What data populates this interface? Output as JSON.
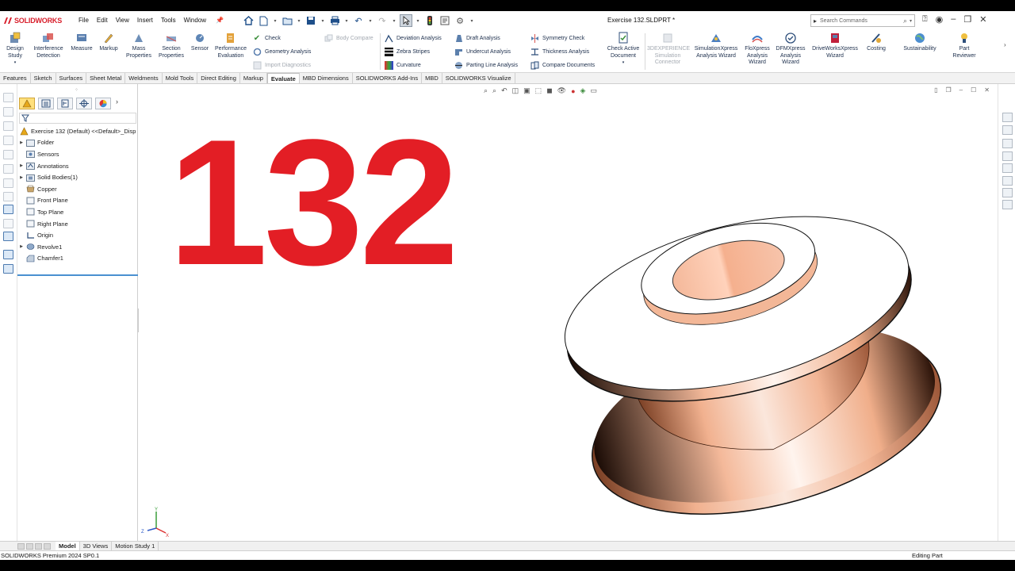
{
  "app": {
    "brand": "SOLIDWORKS",
    "document_title": "Exercise 132.SLDPRT *"
  },
  "menu": [
    "File",
    "Edit",
    "View",
    "Insert",
    "Tools",
    "Window"
  ],
  "search": {
    "placeholder": "Search Commands"
  },
  "ribbon": {
    "design_study": "Design Study",
    "interference_detection": "Interference Detection",
    "measure": "Measure",
    "markup": "Markup",
    "mass_properties": "Mass Properties",
    "section_properties": "Section Properties",
    "sensor": "Sensor",
    "performance_evaluation": "Performance Evaluation",
    "check": "Check",
    "geometry_analysis": "Geometry Analysis",
    "import_diagnostics": "Import Diagnostics",
    "body_compare": "Body Compare",
    "deviation_analysis": "Deviation Analysis",
    "zebra_stripes": "Zebra Stripes",
    "curvature": "Curvature",
    "draft_analysis": "Draft Analysis",
    "undercut_analysis": "Undercut Analysis",
    "parting_line_analysis": "Parting Line Analysis",
    "symmetry_check": "Symmetry Check",
    "thickness_analysis": "Thickness Analysis",
    "compare_documents": "Compare Documents",
    "check_active_document": "Check Active Document",
    "simulation_connector": "3DEXPERIENCE Simulation Connector",
    "simulationxpress": "SimulationXpress Analysis Wizard",
    "floxpress": "FloXpress Analysis Wizard",
    "dfmxpress": "DFMXpress Analysis Wizard",
    "driveworksxpress": "DriveWorksXpress Wizard",
    "costing": "Costing",
    "sustainability": "Sustainability",
    "part_reviewer": "Part Reviewer"
  },
  "tabs": [
    "Features",
    "Sketch",
    "Surfaces",
    "Sheet Metal",
    "Weldments",
    "Mold Tools",
    "Direct Editing",
    "Markup",
    "Evaluate",
    "MBD Dimensions",
    "SOLIDWORKS Add-Ins",
    "MBD",
    "SOLIDWORKS Visualize"
  ],
  "active_tab": "Evaluate",
  "tree": {
    "root": "Exercise 132 (Default) <<Default>_Disp",
    "items": [
      "Folder",
      "Sensors",
      "Annotations",
      "Solid Bodies(1)",
      "Copper",
      "Front Plane",
      "Top Plane",
      "Right Plane",
      "Origin",
      "Revolve1",
      "Chamfer1"
    ]
  },
  "viewport": {
    "overlay_number": "132",
    "material": "Copper",
    "material_color": "#f4b99a"
  },
  "axis": {
    "x": "X",
    "y": "Y",
    "z": "Z"
  },
  "bottom_tabs": [
    "Model",
    "3D Views",
    "Motion Study 1"
  ],
  "status": {
    "left": "SOLIDWORKS Premium 2024 SP0.1",
    "right": "Editing Part"
  },
  "colors": {
    "accent_red": "#e31e25",
    "brand_red": "#d81e2b",
    "selection_blue": "#4a90d0"
  }
}
